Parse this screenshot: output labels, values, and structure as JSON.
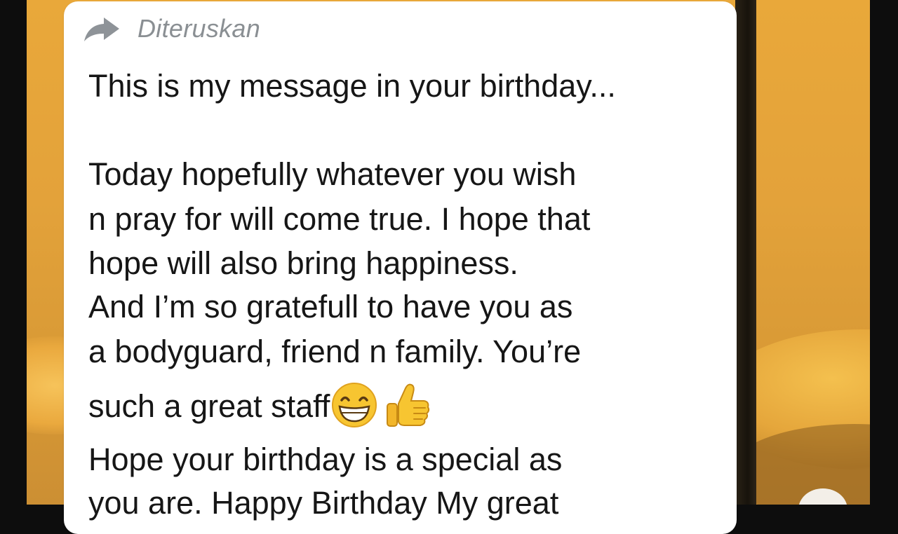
{
  "message": {
    "forwarded_label": "Diteruskan",
    "lines": [
      "This is my message in your birthday...",
      "Today hopefully whatever you wish",
      "n pray for will come true. I hope that",
      "hope will also bring happiness.",
      "And I’m so gratefull to have you as",
      "a bodyguard, friend n family. You’re",
      "such a great staff",
      "Hope your birthday is a special as",
      "you are. Happy Birthday My great"
    ],
    "emojis": [
      "grinning-face-icon",
      "thumbs-up-icon"
    ]
  },
  "colors": {
    "background": "#e3a23a",
    "bubble": "#ffffff",
    "forward_label": "#8a8f93",
    "text": "#161616"
  }
}
